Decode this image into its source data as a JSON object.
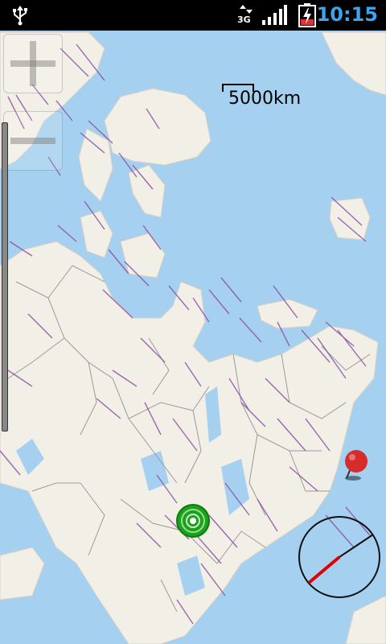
{
  "status_bar": {
    "time": "10:15",
    "network_type": "3G",
    "icons": [
      "usb-icon",
      "data-activity-icon",
      "signal-strength-icon",
      "battery-charging-icon"
    ]
  },
  "map": {
    "scale_label": "5000km",
    "colors": {
      "water": "#a5d0ef",
      "land": "#f2efe7",
      "border": "#9a9a9a",
      "label": "#8a52a4"
    }
  },
  "controls": {
    "zoom_in_icon": "plus-icon",
    "zoom_out_icon": "minus-icon"
  },
  "marker": {
    "color": "#d82c2c"
  },
  "location": {
    "color": "#19a319"
  },
  "compass": {
    "needle_color": "#e00000"
  }
}
